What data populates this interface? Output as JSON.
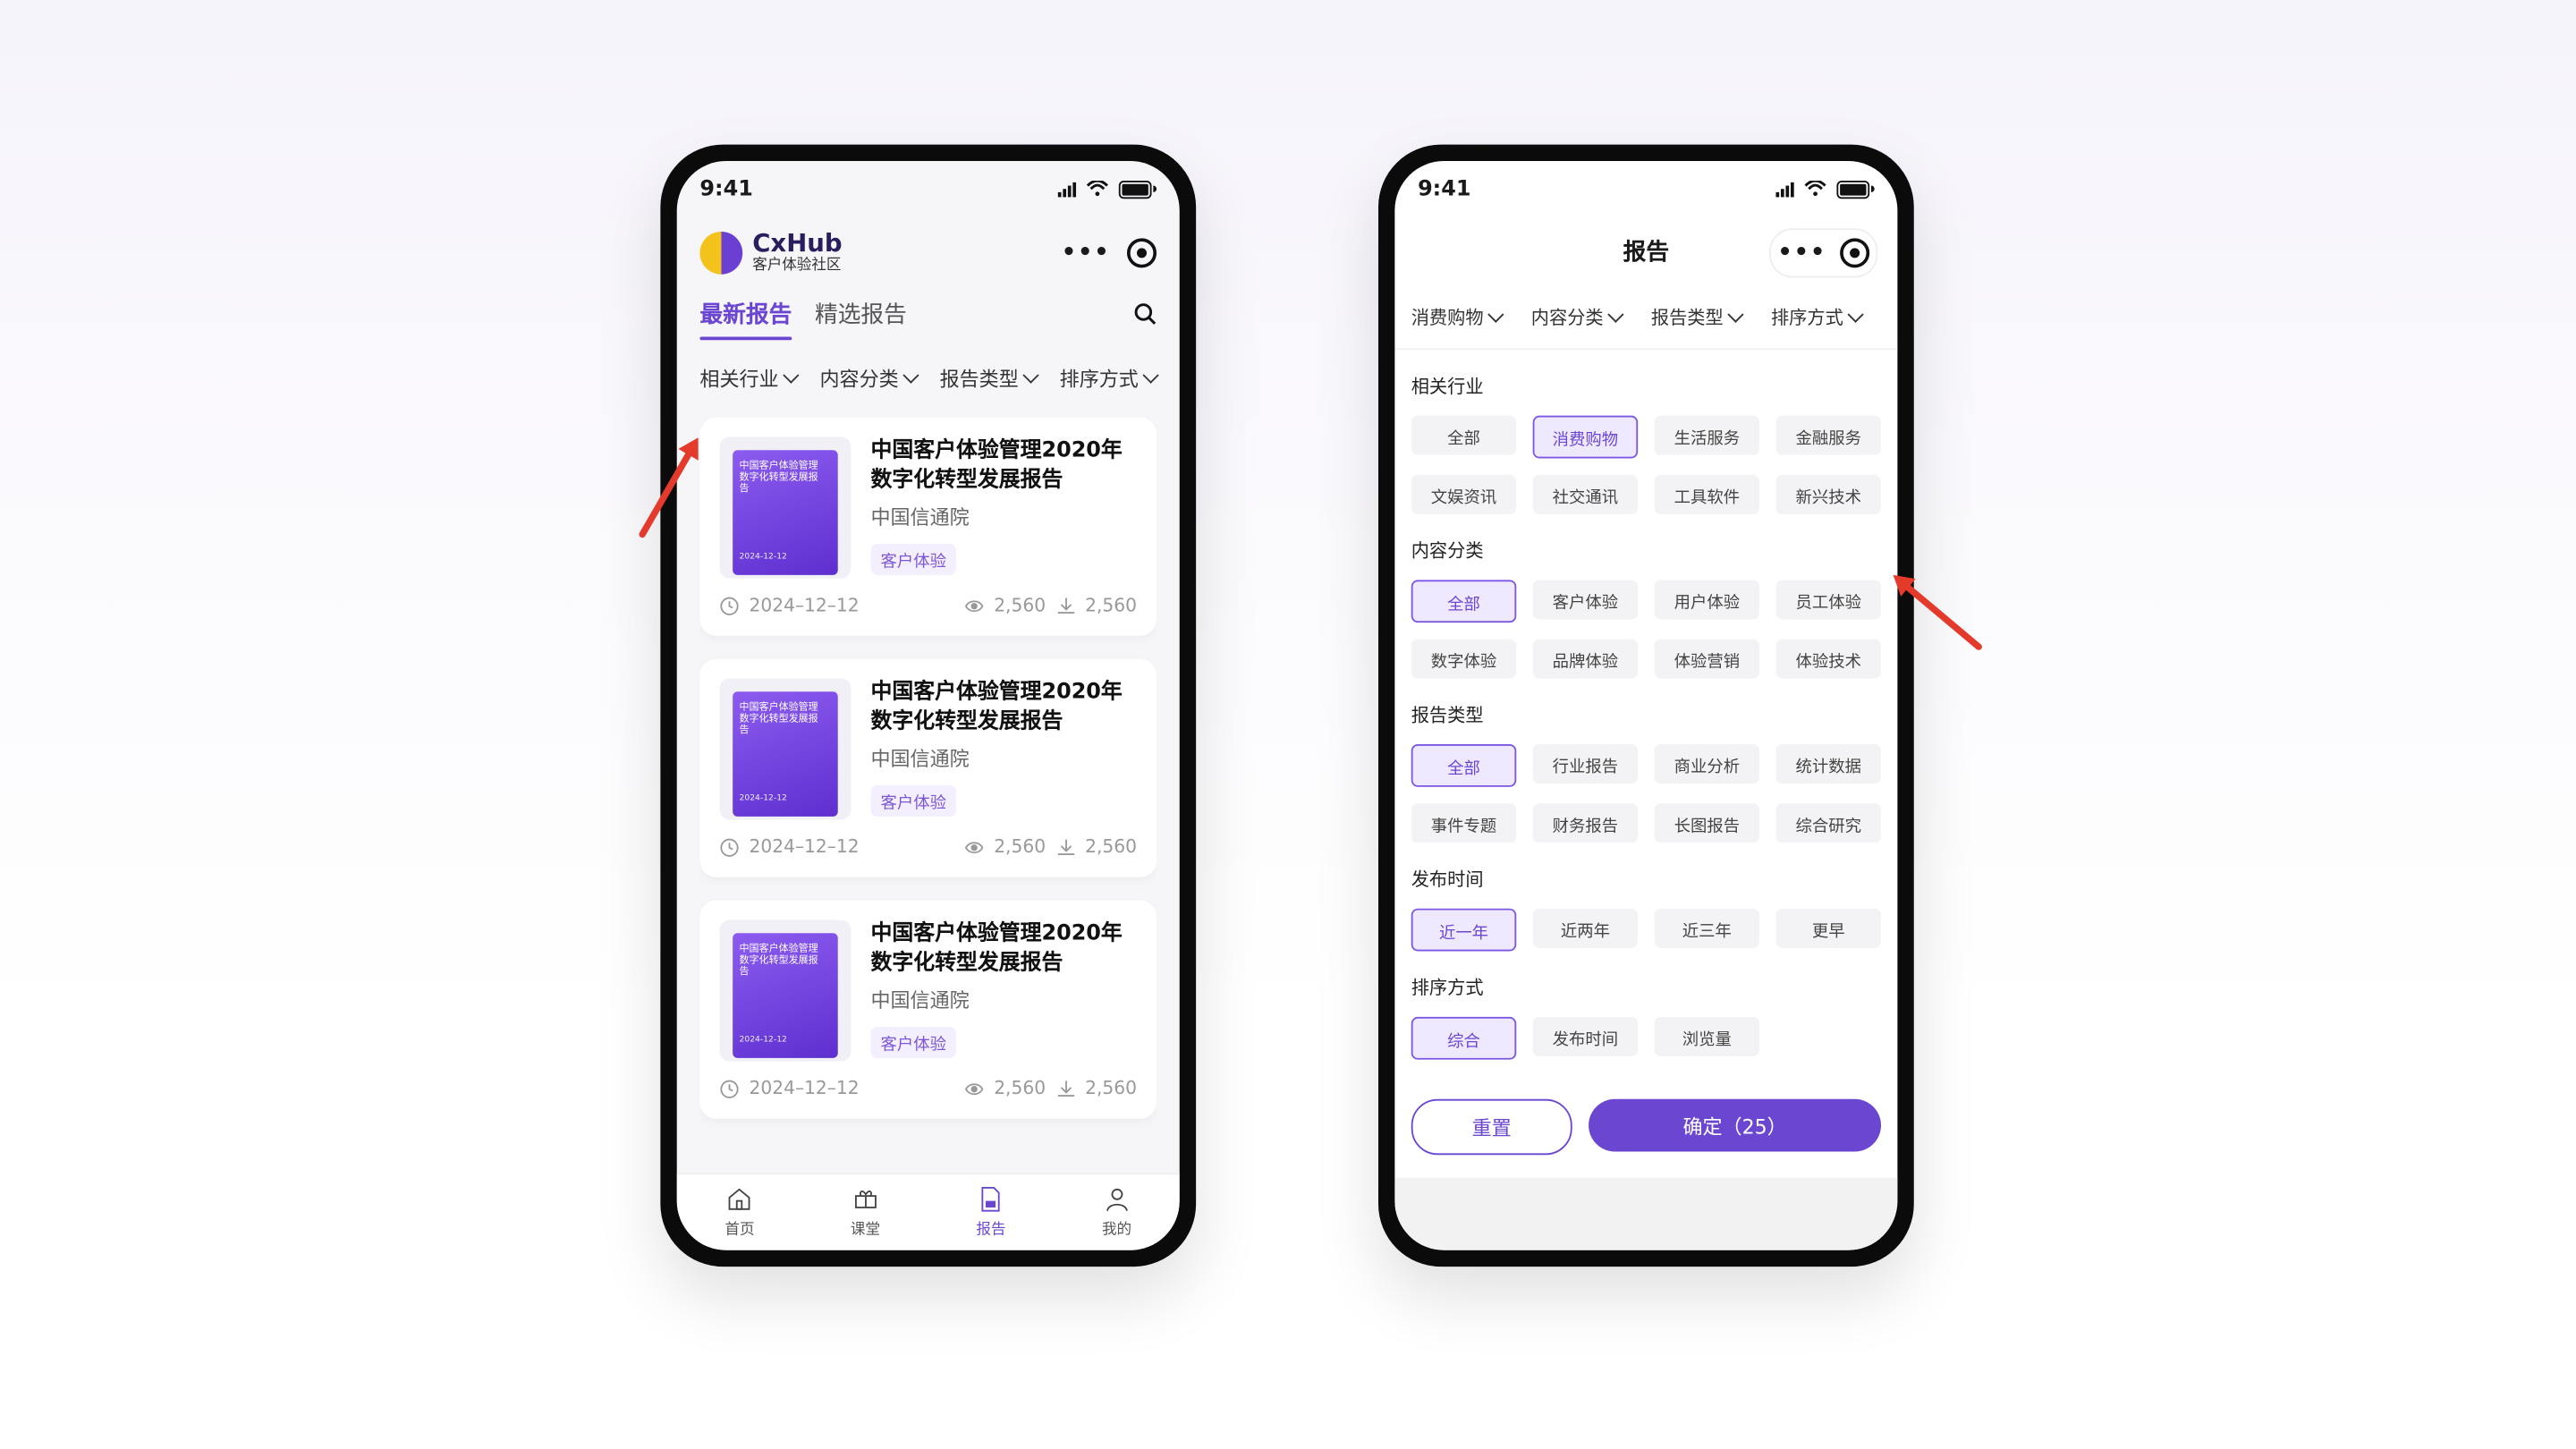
{
  "status": {
    "time": "9:41"
  },
  "left": {
    "brand": {
      "title": "CxHub",
      "subtitle": "客户体验社区"
    },
    "tabs": [
      {
        "label": "最新报告"
      },
      {
        "label": "精选报告"
      }
    ],
    "filters": [
      {
        "label": "相关行业"
      },
      {
        "label": "内容分类"
      },
      {
        "label": "报告类型"
      },
      {
        "label": "排序方式"
      }
    ],
    "cards": [
      {
        "title": "中国客户体验管理2020年数字化转型发展报告",
        "source": "中国信通院",
        "tag": "客户体验",
        "date": "2024–12–12",
        "views": "2,560",
        "downloads": "2,560",
        "cover_title": "中国客户体验管理数字化转型发展报告",
        "cover_date": "2024-12-12"
      },
      {
        "title": "中国客户体验管理2020年数字化转型发展报告",
        "source": "中国信通院",
        "tag": "客户体验",
        "date": "2024–12–12",
        "views": "2,560",
        "downloads": "2,560",
        "cover_title": "中国客户体验管理数字化转型发展报告",
        "cover_date": "2024-12-12"
      },
      {
        "title": "中国客户体验管理2020年数字化转型发展报告",
        "source": "中国信通院",
        "tag": "客户体验",
        "date": "2024–12–12",
        "views": "2,560",
        "downloads": "2,560",
        "cover_title": "中国客户体验管理数字化转型发展报告",
        "cover_date": "2024-12-12"
      }
    ],
    "nav": [
      {
        "label": "首页",
        "icon": "home-icon"
      },
      {
        "label": "课堂",
        "icon": "class-icon"
      },
      {
        "label": "报告",
        "icon": "report-icon"
      },
      {
        "label": "我的",
        "icon": "user-icon"
      }
    ]
  },
  "right": {
    "title": "报告",
    "filters": [
      {
        "label": "消费购物"
      },
      {
        "label": "内容分类"
      },
      {
        "label": "报告类型"
      },
      {
        "label": "排序方式"
      }
    ],
    "sections": [
      {
        "title": "相关行业",
        "options": [
          "全部",
          "消费购物",
          "生活服务",
          "金融服务",
          "文娱资讯",
          "社交通讯",
          "工具软件",
          "新兴技术"
        ],
        "selected": "消费购物"
      },
      {
        "title": "内容分类",
        "options": [
          "全部",
          "客户体验",
          "用户体验",
          "员工体验",
          "数字体验",
          "品牌体验",
          "体验营销",
          "体验技术"
        ],
        "selected": "全部"
      },
      {
        "title": "报告类型",
        "options": [
          "全部",
          "行业报告",
          "商业分析",
          "统计数据",
          "事件专题",
          "财务报告",
          "长图报告",
          "综合研究"
        ],
        "selected": "全部"
      },
      {
        "title": "发布时间",
        "options": [
          "近一年",
          "近两年",
          "近三年",
          "更早"
        ],
        "selected": "近一年"
      },
      {
        "title": "排序方式",
        "options": [
          "综合",
          "发布时间",
          "浏览量"
        ],
        "selected": "综合"
      }
    ],
    "buttons": {
      "reset": "重置",
      "confirm": "确定（25）"
    }
  },
  "colors": {
    "accent": "#6b47d1",
    "arrow": "#e33a2b"
  }
}
